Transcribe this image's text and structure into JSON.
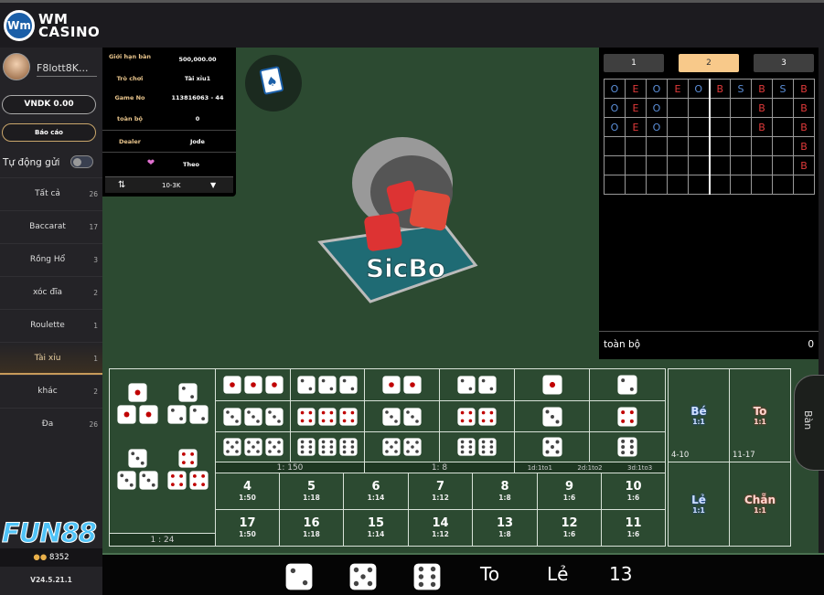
{
  "header": {
    "logo_text": "WM CASINO",
    "logo_line1": "WM",
    "logo_line2": "CASINO"
  },
  "user": {
    "name": "F8lott8K...",
    "balance": "VNDK 0.00",
    "report": "Báo cáo",
    "auto_send": "Tự động gửi",
    "auto_send_on": false
  },
  "categories": [
    {
      "label": "Tất cả",
      "count": "26"
    },
    {
      "label": "Baccarat",
      "count": "17"
    },
    {
      "label": "Rồng Hổ",
      "count": "3"
    },
    {
      "label": "xóc đĩa",
      "count": "2"
    },
    {
      "label": "Roulette",
      "count": "1"
    },
    {
      "label": "Tài xỉu",
      "count": "1",
      "active": true
    },
    {
      "label": "khác",
      "count": "2"
    },
    {
      "label": "Đa",
      "count": "26"
    }
  ],
  "brand": "FUN88",
  "online": "8352",
  "version": "V24.5.21.1",
  "info": {
    "limit_label": "Giới hạn bàn",
    "limit": "500,000.00",
    "game_label": "Trò chơi",
    "game": "Tài xỉu1",
    "gameno_label": "Game No",
    "gameno": "113816063 - 44",
    "total_label": "toàn bộ",
    "total": "0",
    "dealer_label": "Dealer",
    "dealer": "Jode",
    "follow": "Theo",
    "limit_select": "10-3K"
  },
  "game_logo": "SicBo",
  "road": {
    "tabs": [
      "1",
      "2",
      "3"
    ],
    "active_tab": 1,
    "grid": [
      [
        "O",
        "E",
        "O",
        "E",
        "O",
        "B",
        "S",
        "B",
        "S",
        "B"
      ],
      [
        "O",
        "E",
        "O",
        "",
        "",
        "",
        "",
        "B",
        "",
        "B"
      ],
      [
        "O",
        "E",
        "O",
        "",
        "",
        "",
        "",
        "B",
        "",
        "B"
      ],
      [
        "",
        "",
        "",
        "",
        "",
        "",
        "",
        "",
        "",
        "B"
      ],
      [
        "",
        "",
        "",
        "",
        "",
        "",
        "",
        "",
        "",
        "B"
      ],
      [
        "",
        "",
        "",
        "",
        "",
        "",
        "",
        "",
        "",
        ""
      ]
    ],
    "total_label": "toàn bộ",
    "total": "0"
  },
  "bets": {
    "any_triple_odds": "1 : 24",
    "any_triple_faces": [
      1,
      2,
      3,
      4
    ],
    "grid": [
      [
        [
          1,
          1,
          1
        ],
        [
          2,
          2,
          2
        ],
        [
          1,
          1
        ],
        [
          2,
          2
        ],
        [
          1
        ],
        [
          2
        ]
      ],
      [
        [
          3,
          3,
          3
        ],
        [
          4,
          4,
          4
        ],
        [
          3,
          3
        ],
        [
          4,
          4
        ],
        [
          3
        ],
        [
          4
        ]
      ],
      [
        [
          5,
          5,
          5
        ],
        [
          6,
          6,
          6
        ],
        [
          5,
          5
        ],
        [
          6,
          6
        ],
        [
          5
        ],
        [
          6
        ]
      ]
    ],
    "triple_odds": "1: 150",
    "double_odds": "1: 8",
    "single_odds": [
      "1d:1to1",
      "2d:1to2",
      "3d:1to3"
    ],
    "sums_top": [
      {
        "n": "4",
        "o": "1:50"
      },
      {
        "n": "5",
        "o": "1:18"
      },
      {
        "n": "6",
        "o": "1:14"
      },
      {
        "n": "7",
        "o": "1:12"
      },
      {
        "n": "8",
        "o": "1:8"
      },
      {
        "n": "9",
        "o": "1:6"
      },
      {
        "n": "10",
        "o": "1:6"
      }
    ],
    "sums_bottom": [
      {
        "n": "17",
        "o": "1:50"
      },
      {
        "n": "16",
        "o": "1:18"
      },
      {
        "n": "15",
        "o": "1:14"
      },
      {
        "n": "14",
        "o": "1:12"
      },
      {
        "n": "13",
        "o": "1:8"
      },
      {
        "n": "12",
        "o": "1:6"
      },
      {
        "n": "11",
        "o": "1:6"
      }
    ],
    "small": {
      "n": "Bé",
      "o": "1:1",
      "range": "4-10"
    },
    "big": {
      "n": "To",
      "o": "1:1",
      "range": "11-17"
    },
    "odd": {
      "n": "Lẻ",
      "o": "1:1"
    },
    "even": {
      "n": "Chẵn",
      "o": "1:1"
    }
  },
  "side_tab": "Bàn",
  "result": {
    "dice": [
      2,
      5,
      6
    ],
    "bigsmall": "To",
    "oddeven": "Lẻ",
    "sum": "13"
  },
  "colors": {
    "felt": "#2c4a31",
    "gold": "#e9c58c",
    "red_pip": "#c00000",
    "pip": "#444444"
  }
}
